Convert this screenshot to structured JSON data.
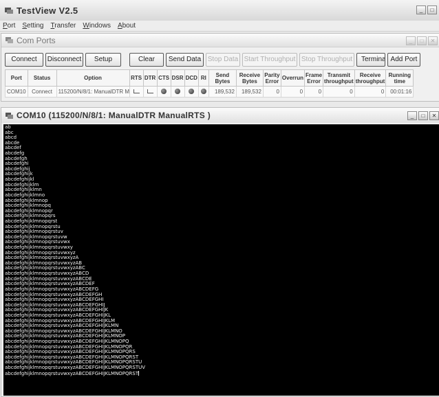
{
  "app": {
    "title": "TestView V2.5",
    "window_controls": [
      "_",
      "□"
    ]
  },
  "menu": {
    "items": [
      {
        "u": "P",
        "rest": "ort"
      },
      {
        "u": "S",
        "rest": "etting"
      },
      {
        "u": "T",
        "rest": "ransfer"
      },
      {
        "u": "W",
        "rest": "indows"
      },
      {
        "u": "A",
        "rest": "bout"
      }
    ]
  },
  "com_ports": {
    "title": "Com Ports",
    "window_controls": [
      "_",
      "□",
      "✕"
    ],
    "toolbar": {
      "connect": "Connect",
      "disconnect": "Disconnect",
      "setup": "Setup",
      "clear": "Clear",
      "send_data": "Send Data",
      "stop_data": "Stop Data",
      "start_throughput": "Start Throughput",
      "stop_throughput": "Stop Throughput",
      "terminal": "Terminal",
      "add_port": "Add Port"
    },
    "columns": [
      "Port",
      "Status",
      "Option",
      "RTS",
      "DTR",
      "CTS",
      "DSR",
      "DCD",
      "RI",
      "Send Bytes",
      "Receive Bytes",
      "Parity Error",
      "Overrun",
      "Frame Error",
      "Transmit throughput",
      "Receive throughput",
      "Running time"
    ],
    "row": {
      "port": "COM10",
      "status": "Connect",
      "option": "115200/N/8/1: ManualDTR Ma",
      "send_bytes": "189,532",
      "receive_bytes": "189,532",
      "parity_error": "0",
      "overrun": "0",
      "frame_error": "0",
      "transmit_throughput": "0",
      "receive_throughput": "0",
      "running_time": "00:01:16"
    }
  },
  "terminal_window": {
    "title": "COM10 (115200/N/8/1: ManualDTR ManualRTS )",
    "window_controls": [
      "_",
      "□",
      "✕"
    ],
    "lines": [
      "ab",
      "abc",
      "abcd",
      "abcde",
      "abcdef",
      "abcdefg",
      "abcdefgh",
      "abcdefghi",
      "abcdefghij",
      "abcdefghijk",
      "abcdefghijkl",
      "abcdefghijklm",
      "abcdefghijklmn",
      "abcdefghijklmno",
      "abcdefghijklmnop",
      "abcdefghijklmnopq",
      "abcdefghijklmnopqr",
      "abcdefghijklmnopqrs",
      "abcdefghijklmnopqrst",
      "abcdefghijklmnopqrstu",
      "abcdefghijklmnopqrstuv",
      "abcdefghijklmnopqrstuvw",
      "abcdefghijklmnopqrstuvwx",
      "abcdefghijklmnopqrstuvwxy",
      "abcdefghijklmnopqrstuvwxyz",
      "abcdefghijklmnopqrstuvwxyzA",
      "abcdefghijklmnopqrstuvwxyzAB",
      "abcdefghijklmnopqrstuvwxyzABC",
      "abcdefghijklmnopqrstuvwxyzABCD",
      "abcdefghijklmnopqrstuvwxyzABCDE",
      "abcdefghijklmnopqrstuvwxyzABCDEF",
      "abcdefghijklmnopqrstuvwxyzABCDEFG",
      "abcdefghijklmnopqrstuvwxyzABCDEFGH",
      "abcdefghijklmnopqrstuvwxyzABCDEFGHI",
      "abcdefghijklmnopqrstuvwxyzABCDEFGHIJ",
      "abcdefghijklmnopqrstuvwxyzABCDEFGHIJK",
      "abcdefghijklmnopqrstuvwxyzABCDEFGHIJKL",
      "abcdefghijklmnopqrstuvwxyzABCDEFGHIJKLM",
      "abcdefghijklmnopqrstuvwxyzABCDEFGHIJKLMN",
      "abcdefghijklmnopqrstuvwxyzABCDEFGHIJKLMNO",
      "abcdefghijklmnopqrstuvwxyzABCDEFGHIJKLMNOP",
      "abcdefghijklmnopqrstuvwxyzABCDEFGHIJKLMNOPQ",
      "abcdefghijklmnopqrstuvwxyzABCDEFGHIJKLMNOPQR",
      "abcdefghijklmnopqrstuvwxyzABCDEFGHIJKLMNOPQRS",
      "abcdefghijklmnopqrstuvwxyzABCDEFGHIJKLMNOPQRST",
      "abcdefghijklmnopqrstuvwxyzABCDEFGHIJKLMNOPQRSTU",
      "abcdefghijklmnopqrstuvwxyzABCDEFGHIJKLMNOPQRSTUV",
      "abcdefghijklmnopqrstuvwxyzABCDEFGHIJKLMNOPQRST"
    ]
  }
}
